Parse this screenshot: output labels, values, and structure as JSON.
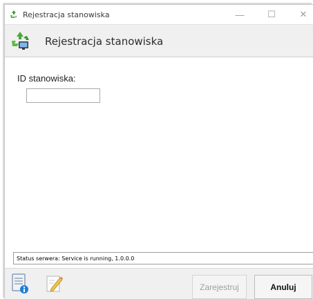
{
  "window": {
    "title": "Rejestracja stanowiska",
    "controls": {
      "minimize": "—",
      "maximize": "☐",
      "close": "✕"
    }
  },
  "header": {
    "title": "Rejestracja stanowiska",
    "icon": "recycle-monitor-icon"
  },
  "form": {
    "id_label": "ID stanowiska:",
    "id_value": "",
    "id_placeholder": ""
  },
  "status": {
    "text": "Status serwera: Service is running, 1.0.0.0"
  },
  "footer": {
    "info_icon": "document-info-icon",
    "edit_icon": "edit-pencil-icon",
    "register_label": "Zarejestruj",
    "register_enabled": false,
    "cancel_label": "Anuluj"
  },
  "colors": {
    "accent_green": "#5fae3a",
    "header_bg": "#f0f0f0",
    "disabled_text": "#a0a0a0"
  }
}
